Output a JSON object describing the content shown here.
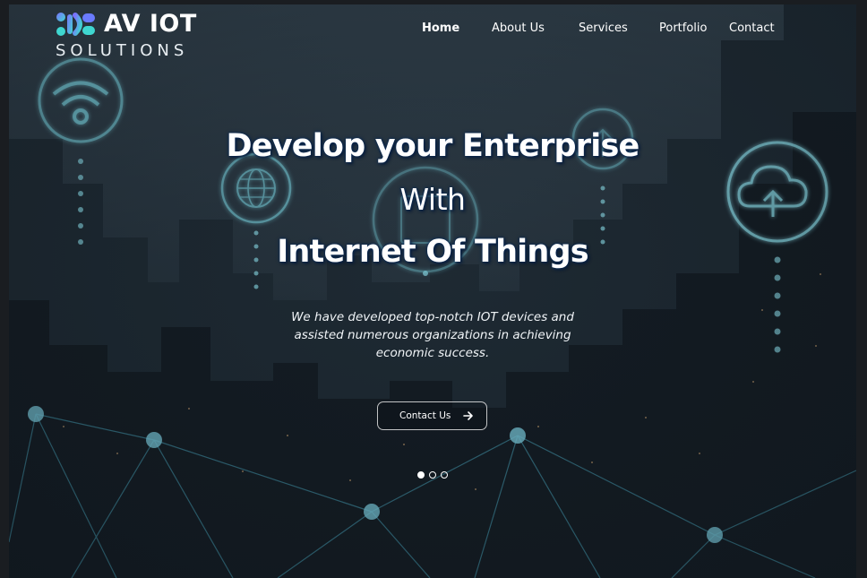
{
  "logo": {
    "top": "AV IOT",
    "bottom": "SOLUTIONS",
    "colors": {
      "accent1": "#6a7bff",
      "accent2": "#3fd6d0"
    }
  },
  "nav": {
    "items": [
      {
        "label": "Home",
        "active": true
      },
      {
        "label": "About Us",
        "active": false
      },
      {
        "label": "Services",
        "active": false
      },
      {
        "label": "Portfolio",
        "active": false
      },
      {
        "label": "Contact",
        "active": false
      }
    ]
  },
  "hero": {
    "line1": "Develop your Enterprise",
    "line2": "With",
    "line3": "Internet Of Things",
    "subtitle": "We have developed top-notch IOT devices and assisted numerous organizations in achieving economic success.",
    "cta_label": "Contact Us",
    "cta_icon": "arrow-right-icon"
  },
  "carousel": {
    "slides": 3,
    "active_index": 0
  },
  "icons": [
    "wifi-icon",
    "globe-icon",
    "cloud-upload-icon",
    "upload-icon"
  ],
  "colors": {
    "glow": "#3fc8d6",
    "background": "#1c2a36",
    "text": "#ffffff"
  }
}
